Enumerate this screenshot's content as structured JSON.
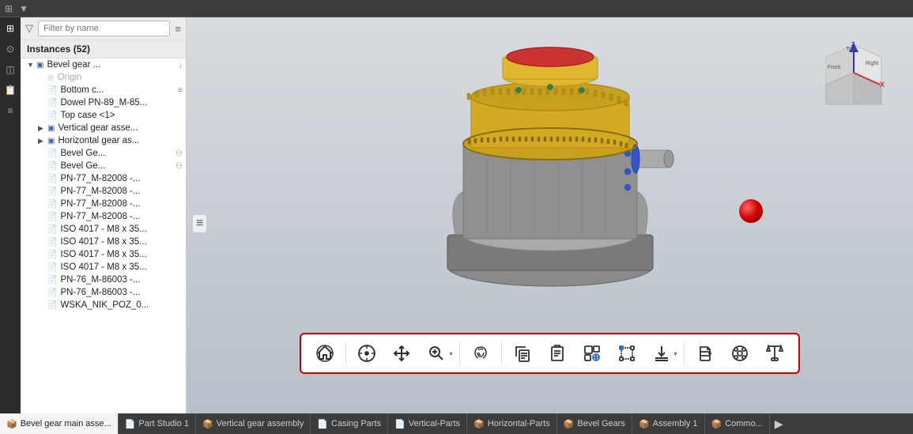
{
  "topbar": {
    "icons": [
      "⚙",
      "≡"
    ]
  },
  "sidebar": {
    "filter_placeholder": "Filter by name",
    "instances_label": "Instances (52)",
    "items": [
      {
        "id": "bevel-gear-main",
        "label": "Bevel gear ...",
        "indent": 0,
        "has_expand": true,
        "icon": "📦",
        "badge": "↓",
        "expanded": true
      },
      {
        "id": "origin",
        "label": "Origin",
        "indent": 1,
        "has_expand": false,
        "icon": "",
        "badge": "",
        "is_origin": true
      },
      {
        "id": "bottom-c",
        "label": "Bottom c...",
        "indent": 1,
        "has_expand": false,
        "icon": "🔧",
        "badge": "≡"
      },
      {
        "id": "dowel",
        "label": "Dowel PN-89_M-85...",
        "indent": 1,
        "has_expand": false,
        "icon": "🔧",
        "badge": ""
      },
      {
        "id": "top-case",
        "label": "Top case <1>",
        "indent": 1,
        "has_expand": false,
        "icon": "🔧",
        "badge": ""
      },
      {
        "id": "vertical-gear",
        "label": "Vertical gear asse...",
        "indent": 1,
        "has_expand": true,
        "icon": "📦",
        "badge": "",
        "expanded": false
      },
      {
        "id": "horizontal-gear",
        "label": "Horizontal gear as...",
        "indent": 1,
        "has_expand": true,
        "icon": "📦",
        "badge": "",
        "expanded": false
      },
      {
        "id": "bevel-ge-1",
        "label": "Bevel Ge...",
        "indent": 1,
        "has_expand": false,
        "icon": "🔧",
        "badge": "👥"
      },
      {
        "id": "bevel-ge-2",
        "label": "Bevel Ge...",
        "indent": 1,
        "has_expand": false,
        "icon": "🔧",
        "badge": "👥"
      },
      {
        "id": "pn-77-1",
        "label": "PN-77_M-82008 -...",
        "indent": 1,
        "has_expand": false,
        "icon": "🔧",
        "badge": ""
      },
      {
        "id": "pn-77-2",
        "label": "PN-77_M-82008 -...",
        "indent": 1,
        "has_expand": false,
        "icon": "🔧",
        "badge": ""
      },
      {
        "id": "pn-77-3",
        "label": "PN-77_M-82008 -...",
        "indent": 1,
        "has_expand": false,
        "icon": "🔧",
        "badge": ""
      },
      {
        "id": "pn-77-4",
        "label": "PN-77_M-82008 -...",
        "indent": 1,
        "has_expand": false,
        "icon": "🔧",
        "badge": ""
      },
      {
        "id": "iso-1",
        "label": "ISO 4017 - M8 x 35...",
        "indent": 1,
        "has_expand": false,
        "icon": "🔧",
        "badge": ""
      },
      {
        "id": "iso-2",
        "label": "ISO 4017 - M8 x 35...",
        "indent": 1,
        "has_expand": false,
        "icon": "🔧",
        "badge": ""
      },
      {
        "id": "iso-3",
        "label": "ISO 4017 - M8 x 35...",
        "indent": 1,
        "has_expand": false,
        "icon": "🔧",
        "badge": ""
      },
      {
        "id": "iso-4",
        "label": "ISO 4017 - M8 x 35...",
        "indent": 1,
        "has_expand": false,
        "icon": "🔧",
        "badge": ""
      },
      {
        "id": "pn-76-1",
        "label": "PN-76_M-86003 -...",
        "indent": 1,
        "has_expand": false,
        "icon": "🔧",
        "badge": ""
      },
      {
        "id": "pn-76-2",
        "label": "PN-76_M-86003 -...",
        "indent": 1,
        "has_expand": false,
        "icon": "🔧",
        "badge": ""
      },
      {
        "id": "wska",
        "label": "WSKA_NIK_POZ_0...",
        "indent": 1,
        "has_expand": false,
        "icon": "🔧",
        "badge": ""
      }
    ]
  },
  "toolbar": {
    "buttons": [
      {
        "id": "home",
        "icon": "⌂",
        "label": "Home",
        "has_arrow": false
      },
      {
        "id": "move",
        "icon": "✥",
        "label": "Move",
        "has_arrow": false
      },
      {
        "id": "translate",
        "icon": "✛",
        "label": "Translate",
        "has_arrow": false
      },
      {
        "id": "zoom",
        "icon": "⊕",
        "label": "Zoom",
        "has_arrow": true
      },
      {
        "id": "fingerprint",
        "icon": "◈",
        "label": "Fingerprint",
        "has_arrow": false
      },
      {
        "id": "copy",
        "icon": "⧉",
        "label": "Copy",
        "has_arrow": false
      },
      {
        "id": "document",
        "icon": "📋",
        "label": "Document",
        "has_arrow": false
      },
      {
        "id": "link",
        "icon": "⧉",
        "label": "Link",
        "has_arrow": false
      },
      {
        "id": "crop",
        "icon": "⬚",
        "label": "Crop",
        "has_arrow": false
      },
      {
        "id": "download",
        "icon": "↓",
        "label": "Download",
        "has_arrow": true
      },
      {
        "id": "print",
        "icon": "⎙",
        "label": "Print",
        "has_arrow": false
      },
      {
        "id": "record",
        "icon": "⏺",
        "label": "Record",
        "has_arrow": false
      },
      {
        "id": "scale",
        "icon": "⚖",
        "label": "Scale",
        "has_arrow": false
      }
    ]
  },
  "tabs": [
    {
      "id": "bevel-gear-main-asm",
      "label": "Bevel gear main asse...",
      "icon": "📦",
      "active": true
    },
    {
      "id": "part-studio-1",
      "label": "Part Studio 1",
      "icon": "📄",
      "active": false
    },
    {
      "id": "vertical-gear-assembly",
      "label": "Vertical gear assembly",
      "icon": "📦",
      "active": false
    },
    {
      "id": "casing-parts",
      "label": "Casing Parts",
      "icon": "📄",
      "active": false
    },
    {
      "id": "vertical-parts",
      "label": "Vertical-Parts",
      "icon": "📄",
      "active": false
    },
    {
      "id": "horizontal-parts",
      "label": "Horizontal-Parts",
      "icon": "📦",
      "active": false
    },
    {
      "id": "bevel-gears",
      "label": "Bevel Gears",
      "icon": "📦",
      "active": false
    },
    {
      "id": "assembly-1",
      "label": "Assembly 1",
      "icon": "📦",
      "active": false
    },
    {
      "id": "common",
      "label": "Commo...",
      "icon": "📦",
      "active": false
    }
  ],
  "cube": {
    "top_label": "Top",
    "front_label": "Front",
    "right_label": "Right",
    "z_color": "#3333cc",
    "x_color": "#cc3333"
  },
  "side_icons": [
    "⊞",
    "⊙",
    "◫",
    "📋",
    "≡"
  ]
}
